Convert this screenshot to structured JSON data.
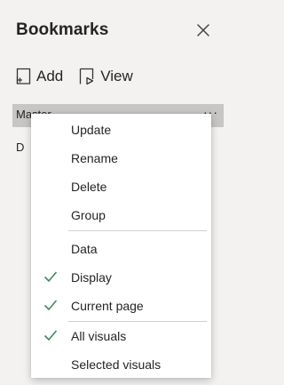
{
  "pane": {
    "title": "Bookmarks",
    "close_icon": "close-icon",
    "toolbar": {
      "add_label": "Add",
      "add_icon": "add-bookmark-icon",
      "view_label": "View",
      "view_icon": "view-bookmark-icon"
    },
    "bookmarks": [
      {
        "label": "Master",
        "more_label": "···"
      },
      {
        "label": "D"
      }
    ]
  },
  "menu": {
    "items": [
      {
        "label": "Update",
        "checked": false
      },
      {
        "label": "Rename",
        "checked": false
      },
      {
        "label": "Delete",
        "checked": false
      },
      {
        "label": "Group",
        "checked": false
      },
      {
        "label": "Data",
        "checked": false
      },
      {
        "label": "Display",
        "checked": true
      },
      {
        "label": "Current page",
        "checked": true
      },
      {
        "label": "All visuals",
        "checked": true
      },
      {
        "label": "Selected visuals",
        "checked": false
      }
    ],
    "check_color": "#3c8a5a"
  }
}
